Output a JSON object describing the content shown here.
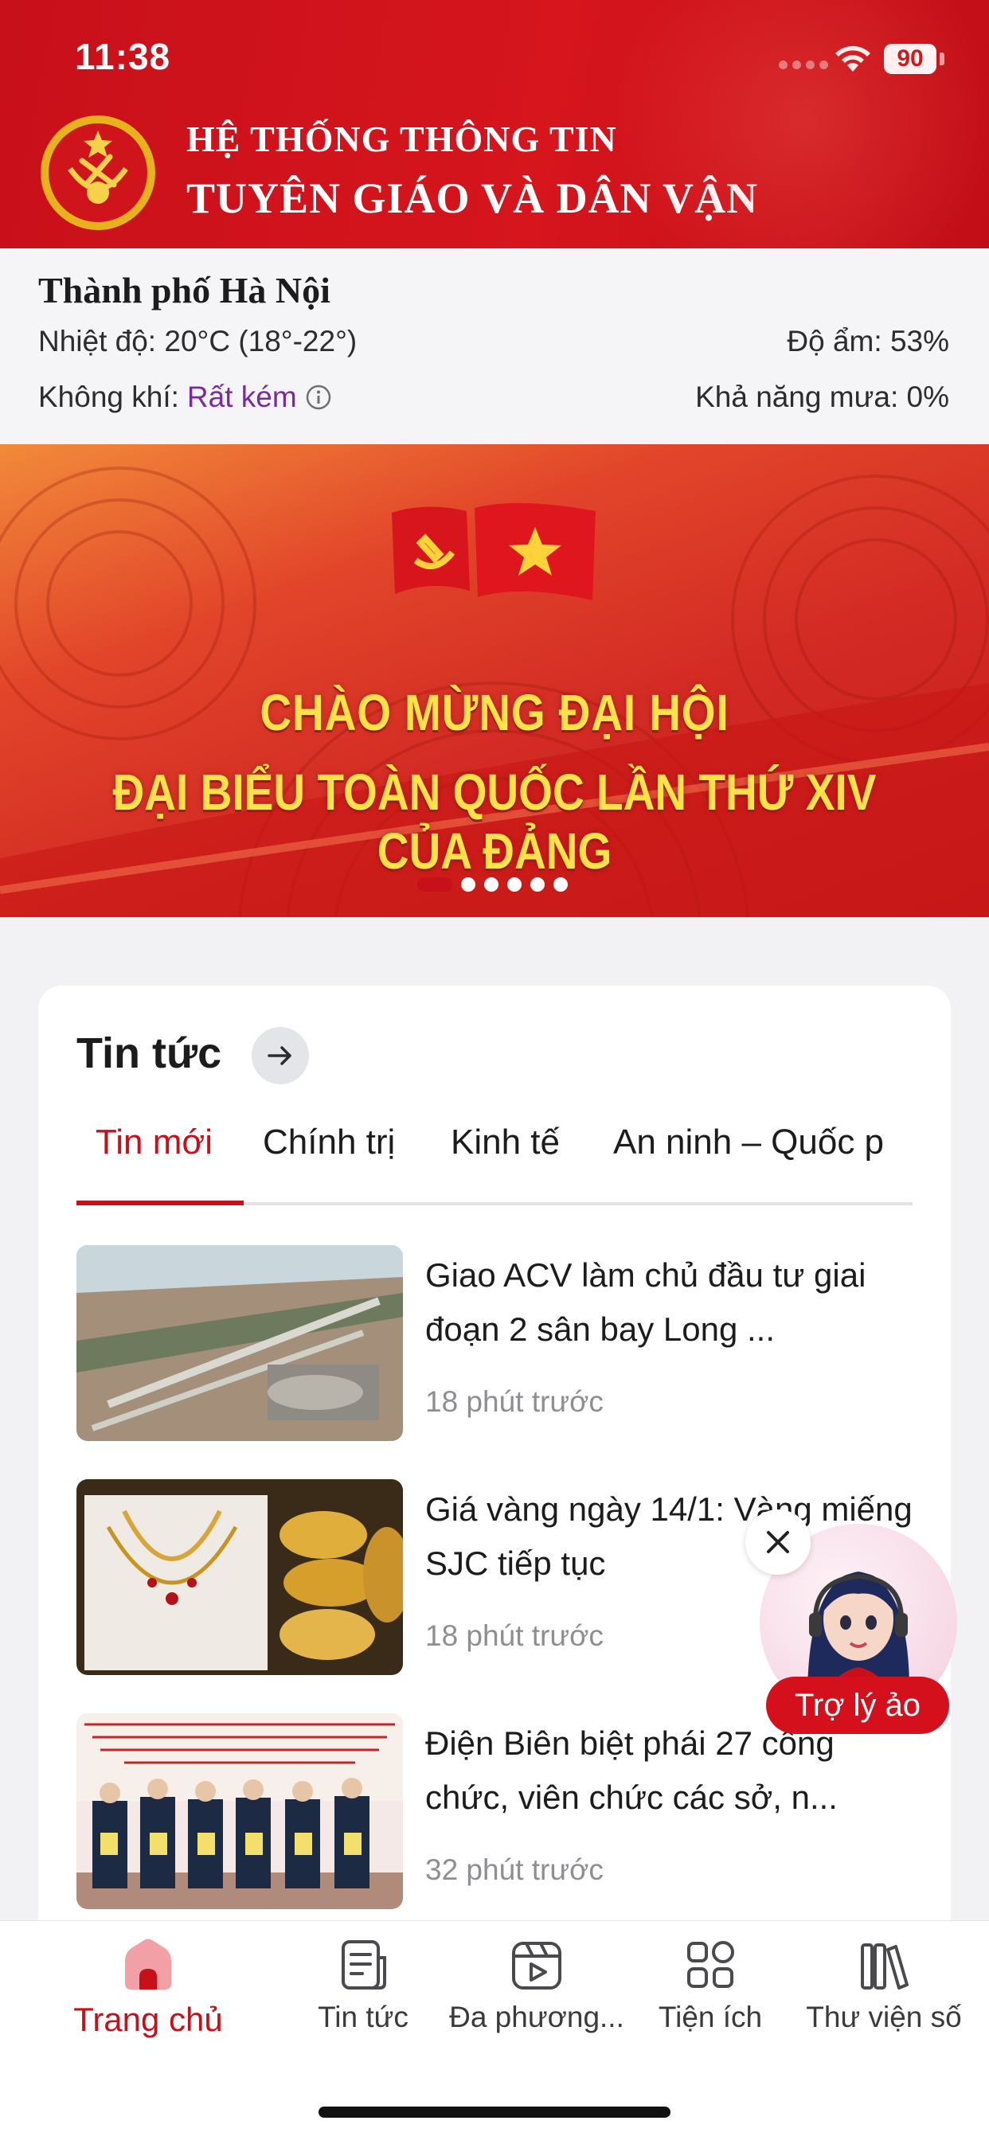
{
  "status_bar": {
    "time": "11:38",
    "battery": "90"
  },
  "header": {
    "title_line_1": "HỆ THỐNG THÔNG TIN",
    "title_line_2": "TUYÊN GIÁO VÀ DÂN VẬN",
    "emblem_text": "TUYÊN GIÁO VÀ DÂN VẬN"
  },
  "weather": {
    "city": "Thành phố Hà Nội",
    "temperature": "Nhiệt độ: 20°C (18°-22°)",
    "humidity": "Độ ẩm: 53%",
    "air_label": "Không khí:",
    "air_value": "Rất kém",
    "rain": "Khả năng mưa: 0%"
  },
  "banner": {
    "line_1": "CHÀO MỪNG ĐẠI HỘI",
    "line_2": "ĐẠI BIỂU TOÀN QUỐC LẦN THỨ XIV CỦA ĐẢNG",
    "slide_count": 6,
    "active_slide": 1
  },
  "news": {
    "title": "Tin tức",
    "tabs": [
      "Tin mới",
      "Chính trị",
      "Kinh tế",
      "An ninh – Quốc p"
    ],
    "active_tab": 0,
    "items": [
      {
        "title": "Giao ACV làm chủ đầu tư giai đoạn 2 sân bay Long ...",
        "time": "18 phút trước"
      },
      {
        "title": "Giá vàng ngày 14/1: Vàng miếng SJC tiếp tục",
        "time": "18 phút trước"
      },
      {
        "title": "Điện Biên biệt phái 27 công chức, viên chức các sở, n...",
        "time": "32 phút trước"
      }
    ]
  },
  "assistant": {
    "label": "Trợ lý ảo"
  },
  "bottom_nav": {
    "items": [
      {
        "label": "Trang chủ",
        "icon": "home-icon"
      },
      {
        "label": "Tin tức",
        "icon": "news-icon"
      },
      {
        "label": "Đa phương...",
        "icon": "media-icon"
      },
      {
        "label": "Tiện ích",
        "icon": "apps-icon"
      },
      {
        "label": "Thư viện số",
        "icon": "library-icon"
      }
    ],
    "active": 0
  },
  "colors": {
    "brand_red": "#c8101a",
    "accent_yellow": "#ffe24a",
    "air_quality": "#7a2a9c"
  }
}
